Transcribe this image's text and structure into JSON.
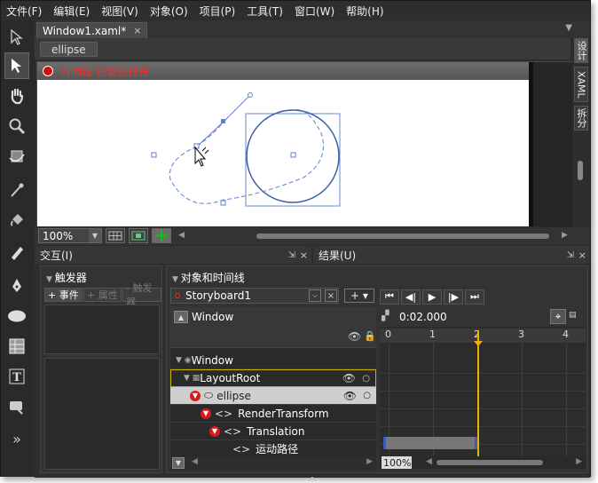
{
  "menu": [
    "文件(F)",
    "编辑(E)",
    "视图(V)",
    "对象(O)",
    "项目(P)",
    "工具(T)",
    "窗口(W)",
    "帮助(H)"
  ],
  "doc_tab": {
    "title": "Window1.xaml*",
    "close": "×"
  },
  "breadcrumb": "ellipse",
  "recording": {
    "text": "时间线 记录已打开"
  },
  "side_tabs": [
    "设计",
    "XAML",
    "拆分"
  ],
  "zoom": "100%",
  "panels": {
    "interaction": {
      "title": "交互(I)"
    },
    "results": {
      "title": "结果(U)"
    },
    "triggers": {
      "title": "触发器",
      "add_event": "+ 事件",
      "add_property": "+ 属性",
      "remove_trigger": "- 触发器"
    },
    "objects": {
      "title": "对象和时间线",
      "storyboard": "Storyboard1",
      "scope": "Window",
      "time": "0:02.000",
      "zoom": "100%"
    }
  },
  "tree": [
    {
      "label": "Window",
      "indent": 0
    },
    {
      "label": "LayoutRoot",
      "indent": 1
    },
    {
      "label": "ellipse",
      "indent": 2
    },
    {
      "label": "RenderTransform",
      "indent": 3
    },
    {
      "label": "Translation",
      "indent": 4
    },
    {
      "label": "运动路径",
      "indent": 5
    }
  ],
  "ruler": [
    "0",
    "1",
    "2",
    "3",
    "4"
  ],
  "colors": {
    "record": "#d01010",
    "playhead": "#e7b300",
    "accent": "#c0171c"
  }
}
